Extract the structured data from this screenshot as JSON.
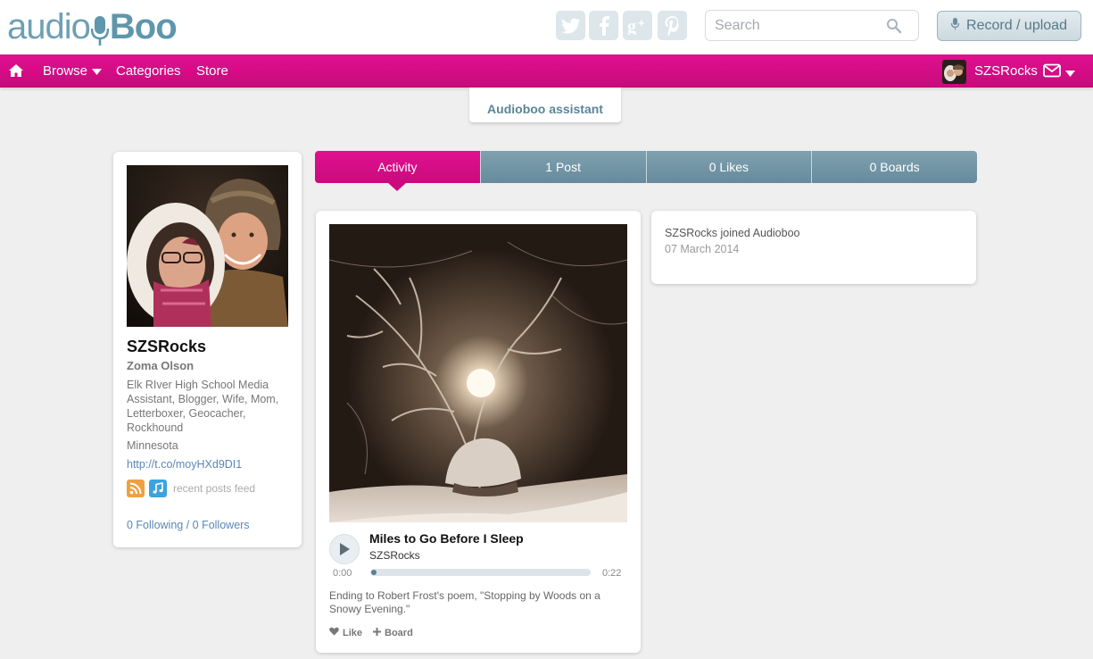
{
  "header": {
    "logo_part1": "audio",
    "logo_part2": "Boo",
    "social_icons": [
      "twitter-icon",
      "facebook-icon",
      "google-plus-icon",
      "pinterest-icon"
    ],
    "search_placeholder": "Search",
    "record_label": "Record / upload"
  },
  "nav": {
    "items": [
      {
        "label": "Browse",
        "dropdown": true
      },
      {
        "label": "Categories"
      },
      {
        "label": "Store"
      }
    ],
    "user": "SZSRocks"
  },
  "assistant_label": "Audioboo assistant",
  "profile": {
    "username": "SZSRocks",
    "fullname": "Zoma Olson",
    "bio": "Elk RIver High School Media Assistant, Blogger, Wife, Mom, Letterboxer, Geocacher, Rockhound",
    "location": "Minnesota",
    "link": "http://t.co/moyHXd9DI1",
    "feed_label": "recent posts feed",
    "follow_text": "0 Following / 0 Followers"
  },
  "tabs": [
    "Activity",
    "1 Post",
    "0 Likes",
    "0 Boards"
  ],
  "post": {
    "title": "Miles to Go Before I Sleep",
    "author": "SZSRocks",
    "time_start": "0:00",
    "time_end": "0:22",
    "progress": 0,
    "description": "Ending to Robert Frost's poem, \"Stopping by Woods on a Snowy Evening.\"",
    "like_label": "Like",
    "board_label": "Board"
  },
  "activity": {
    "text": "SZSRocks joined Audioboo",
    "date": "07 March 2014"
  },
  "colors": {
    "accent": "#d20d85",
    "tab_inactive": "#6f93a3",
    "link": "#5a87b8"
  }
}
